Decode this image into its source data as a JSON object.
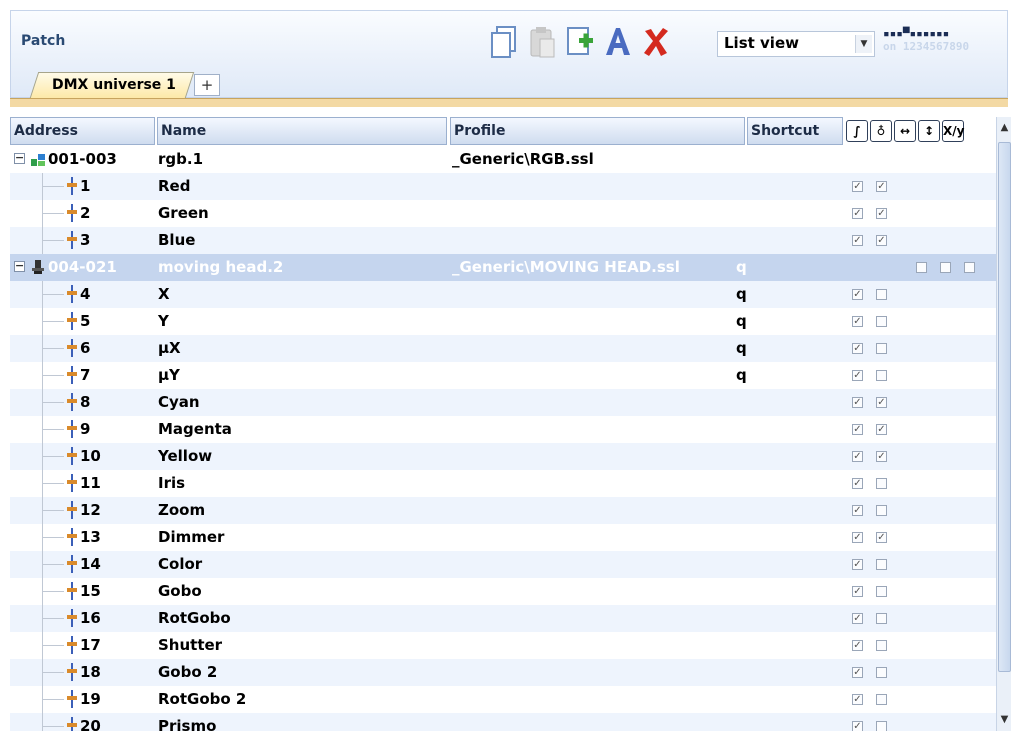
{
  "window": {
    "title": "Patch"
  },
  "toolbar": {
    "view_select": "List view",
    "dmx_indicator_on": "on",
    "dmx_indicator_digits": "1234567890"
  },
  "tabs": [
    {
      "label": "DMX universe 1"
    }
  ],
  "add_tab_label": "+",
  "columns": {
    "address": "Address",
    "name": "Name",
    "profile": "Profile",
    "shortcut": "Shortcut"
  },
  "column_icons": [
    "fade-curve-icon",
    "bulb-icon",
    "pan-icon",
    "tilt-icon",
    "xy-icon"
  ],
  "column_icon_xy_label": "X/y",
  "fixtures": [
    {
      "address": "001-003",
      "name": "rgb.1",
      "profile": "_Generic\\RGB.ssl",
      "shortcut": "",
      "channels": [
        {
          "num": "1",
          "name": "Red",
          "shortcut": "",
          "c1": true,
          "c2": true
        },
        {
          "num": "2",
          "name": "Green",
          "shortcut": "",
          "c1": true,
          "c2": true
        },
        {
          "num": "3",
          "name": "Blue",
          "shortcut": "",
          "c1": true,
          "c2": true
        }
      ]
    },
    {
      "address": "004-021",
      "name": "moving head.2",
      "profile": "_Generic\\MOVING HEAD.ssl",
      "shortcut": "q",
      "channels": [
        {
          "num": "4",
          "name": "X",
          "shortcut": "q",
          "c1": true,
          "c2": false
        },
        {
          "num": "5",
          "name": "Y",
          "shortcut": "q",
          "c1": true,
          "c2": false
        },
        {
          "num": "6",
          "name": "µX",
          "shortcut": "q",
          "c1": true,
          "c2": false
        },
        {
          "num": "7",
          "name": "µY",
          "shortcut": "q",
          "c1": true,
          "c2": false
        },
        {
          "num": "8",
          "name": "Cyan",
          "shortcut": "",
          "c1": true,
          "c2": true
        },
        {
          "num": "9",
          "name": "Magenta",
          "shortcut": "",
          "c1": true,
          "c2": true
        },
        {
          "num": "10",
          "name": "Yellow",
          "shortcut": "",
          "c1": true,
          "c2": true
        },
        {
          "num": "11",
          "name": "Iris",
          "shortcut": "",
          "c1": true,
          "c2": false
        },
        {
          "num": "12",
          "name": "Zoom",
          "shortcut": "",
          "c1": true,
          "c2": false
        },
        {
          "num": "13",
          "name": "Dimmer",
          "shortcut": "",
          "c1": true,
          "c2": true
        },
        {
          "num": "14",
          "name": "Color",
          "shortcut": "",
          "c1": true,
          "c2": false
        },
        {
          "num": "15",
          "name": "Gobo",
          "shortcut": "",
          "c1": true,
          "c2": false
        },
        {
          "num": "16",
          "name": "RotGobo",
          "shortcut": "",
          "c1": true,
          "c2": false
        },
        {
          "num": "17",
          "name": "Shutter",
          "shortcut": "",
          "c1": true,
          "c2": false
        },
        {
          "num": "18",
          "name": "Gobo 2",
          "shortcut": "",
          "c1": true,
          "c2": false
        },
        {
          "num": "19",
          "name": "RotGobo 2",
          "shortcut": "",
          "c1": true,
          "c2": false
        },
        {
          "num": "20",
          "name": "Prismo",
          "shortcut": "",
          "c1": true,
          "c2": false
        }
      ]
    }
  ],
  "colors": {
    "selected_row": "#c5d5ee",
    "alt_row": "#eef4fd",
    "header_text": "#2a4a73"
  }
}
